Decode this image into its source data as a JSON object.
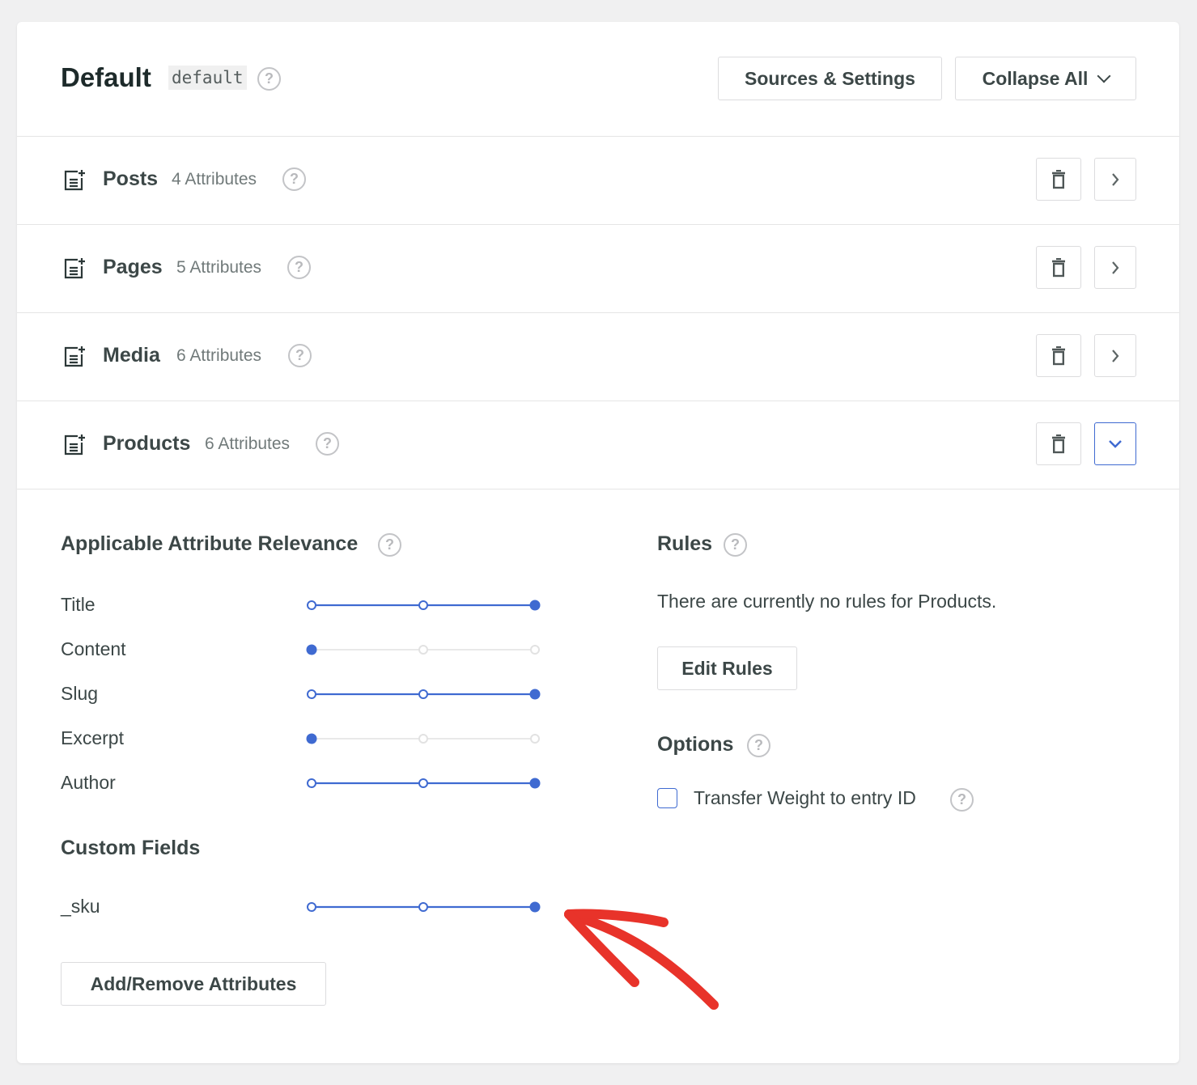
{
  "header": {
    "title": "Default",
    "slug": "default",
    "help_icon": "question-circle-icon",
    "buttons": {
      "sources_settings": "Sources & Settings",
      "collapse_all": "Collapse All"
    }
  },
  "sources": [
    {
      "name": "Posts",
      "count": "4 Attributes",
      "expanded": false
    },
    {
      "name": "Pages",
      "count": "5 Attributes",
      "expanded": false
    },
    {
      "name": "Media",
      "count": "6 Attributes",
      "expanded": false
    },
    {
      "name": "Products",
      "count": "6 Attributes",
      "expanded": true
    }
  ],
  "panel": {
    "relevance_heading": "Applicable Attribute Relevance",
    "attributes": [
      {
        "label": "Title",
        "level": 3,
        "max": 3
      },
      {
        "label": "Content",
        "level": 1,
        "max": 3
      },
      {
        "label": "Slug",
        "level": 3,
        "max": 3
      },
      {
        "label": "Excerpt",
        "level": 1,
        "max": 3
      },
      {
        "label": "Author",
        "level": 3,
        "max": 3
      }
    ],
    "custom_fields_heading": "Custom Fields",
    "custom_fields": [
      {
        "label": "_sku",
        "level": 3,
        "max": 3
      }
    ],
    "add_remove_label": "Add/Remove Attributes",
    "rules_heading": "Rules",
    "rules_empty_text": "There are currently no rules for Products.",
    "edit_rules_label": "Edit Rules",
    "options_heading": "Options",
    "transfer_weight_label": "Transfer Weight to entry ID",
    "transfer_weight_checked": false
  },
  "colors": {
    "accent": "#3f6ad1",
    "inactive_track": "#e2e2e2",
    "annotation_arrow": "#e8332a"
  }
}
